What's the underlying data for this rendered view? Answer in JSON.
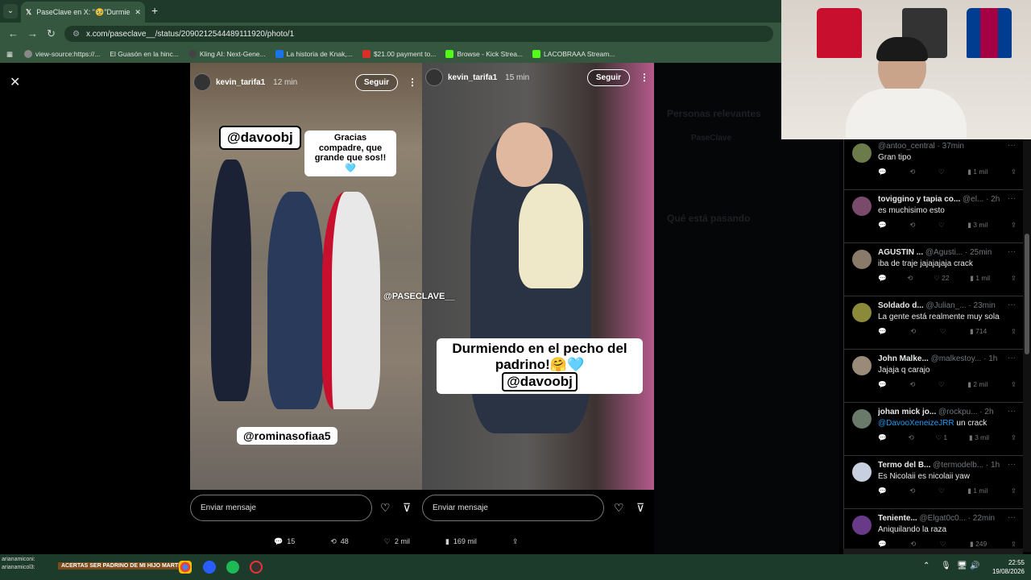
{
  "browser": {
    "tab_title": "PaseClave en X: \"🥹\"Durmie",
    "url": "x.com/paseclave__/status/2090212544489111920/photo/1",
    "bookmarks": [
      {
        "label": "view-source:https://...",
        "color": "#888888"
      },
      {
        "label": "El Guasón en la hinc...",
        "color": "#333333"
      },
      {
        "label": "Kling AI: Next-Gene...",
        "color": "#444444"
      },
      {
        "label": "La historia de Knak,...",
        "color": "#1a73e8"
      },
      {
        "label": "$21.00 payment to...",
        "color": "#d93025"
      },
      {
        "label": "Browse - Kick Strea...",
        "color": "#53fc18"
      },
      {
        "label": "LACOBRAAA Stream...",
        "color": "#53fc18"
      }
    ]
  },
  "viewer": {
    "story1": {
      "username": "kevin_tarifa1",
      "time": "12 min",
      "follow": "Seguir",
      "mention": "@davoobj",
      "caption": "Gracias compadre, que grande que sos!!🩵",
      "tag": "@rominasofiaa5",
      "watermark": "@PASECLAVE__"
    },
    "story2": {
      "username": "kevin_tarifa1",
      "time": "15 min",
      "follow": "Seguir",
      "caption_line1": "Durmiendo en el pecho del",
      "caption_line2": "padrino!🤗🩵",
      "mention": "@davoobj"
    },
    "message_placeholder": "Enviar mensaje",
    "stats": {
      "replies": "15",
      "reposts": "48",
      "likes": "2 mil",
      "views": "169 mil"
    }
  },
  "sidebar_ghost": {
    "relevant_people": "Personas relevantes",
    "account": "PaseClave",
    "whats_happening": "Qué está pasando"
  },
  "replies": [
    {
      "name": "",
      "handle": "@antoo_central · 37min",
      "text": "Gran tipo",
      "comments": "",
      "reposts": "",
      "likes": "",
      "views": "1 mil",
      "avatar": "#6b7b4a"
    },
    {
      "name": "toviggino y tapia co...",
      "handle": "@el... · 2h",
      "text": "es muchisimo esto",
      "comments": "",
      "reposts": "",
      "likes": "",
      "views": "3 mil",
      "avatar": "#7a4a6a"
    },
    {
      "name": "AGUSTIN ...",
      "handle": "@Agusti... · 25min",
      "text": "iba de traje jajajajaja crack",
      "comments": "",
      "reposts": "",
      "likes": "22",
      "views": "1 mil",
      "avatar": "#8a7a6a"
    },
    {
      "name": "Soldado d...",
      "handle": "@Julian_... · 23min",
      "text": "La gente está realmente muy sola",
      "comments": "",
      "reposts": "",
      "likes": "",
      "views": "714",
      "avatar": "#8a8a3a"
    },
    {
      "name": "John Malke...",
      "handle": "@malkestoy... · 1h",
      "text": "Jajaja q carajo",
      "comments": "",
      "reposts": "",
      "likes": "",
      "views": "2 mil",
      "avatar": "#9a8a7a"
    },
    {
      "name": "johan mick jo...",
      "handle": "@rockpu... · 2h",
      "text_mention": "@DavooXeneizeJRR",
      "text": " un crack",
      "comments": "",
      "reposts": "",
      "likes": "1",
      "views": "3 mil",
      "avatar": "#6a7a6a"
    },
    {
      "name": "Termo del B...",
      "handle": "@termodelb... · 1h",
      "text": "Es Nicolaii es nicolaii yaw",
      "comments": "",
      "reposts": "",
      "likes": "",
      "views": "1 mil",
      "avatar": "#c8d0e0"
    },
    {
      "name": "Teniente...",
      "handle": "@Elgat0c0... · 22min",
      "text": "Aniquilando la raza",
      "comments": "",
      "reposts": "",
      "likes": "",
      "views": "249",
      "avatar": "#6a3a8a"
    }
  ],
  "taskbar": {
    "stream_title": "ACERTAS SER PADRINO DE MI HIJO MARTIN",
    "chat1": "arianamiconi:",
    "chat2": "arianamicol3:",
    "time": "22:55",
    "date": "19/08/2026"
  }
}
